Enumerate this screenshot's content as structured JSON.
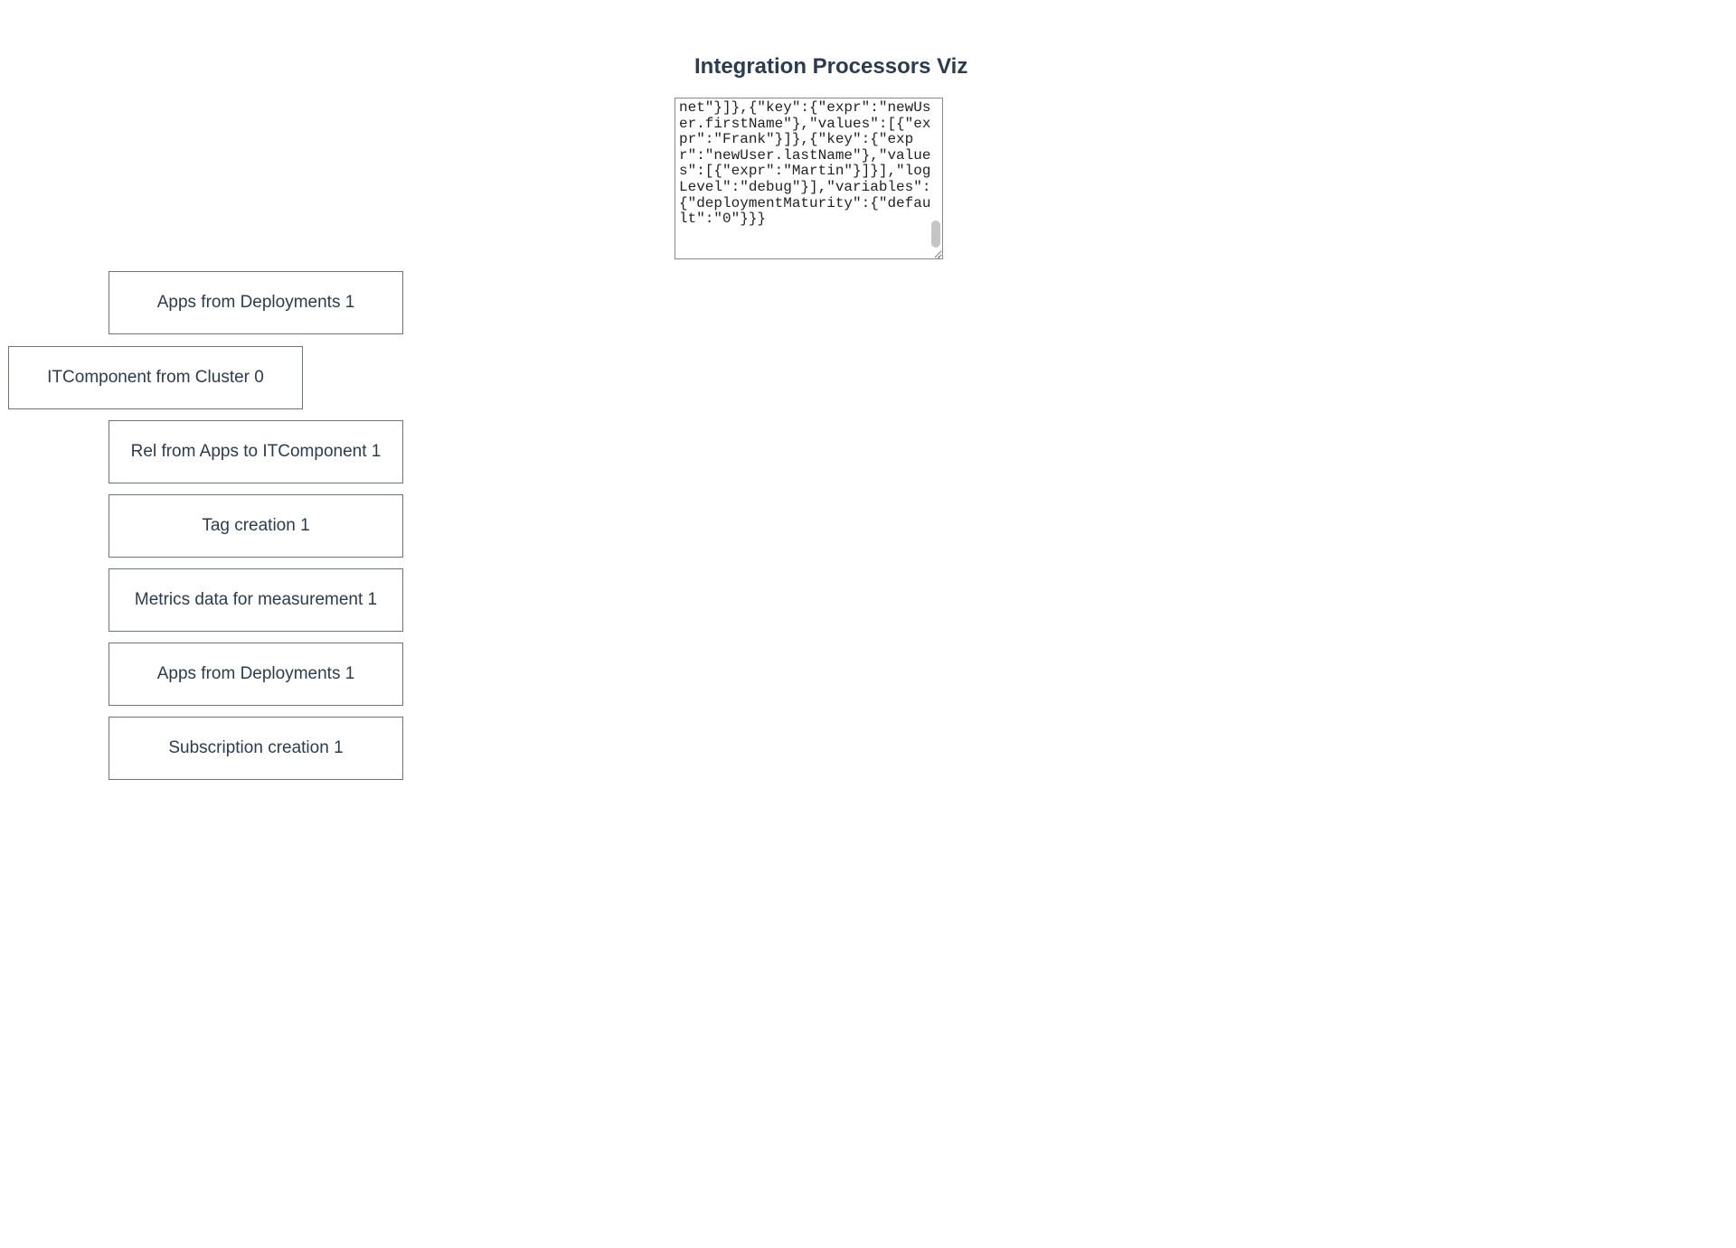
{
  "header": {
    "title": "Integration Processors Viz"
  },
  "json_content": "net\"}]},{\"key\":{\"expr\":\"newUser.firstName\"},\"values\":[{\"expr\":\"Frank\"}]},{\"key\":{\"expr\":\"newUser.lastName\"},\"values\":[{\"expr\":\"Martin\"}]}],\"logLevel\":\"debug\"}],\"variables\":{\"deploymentMaturity\":{\"default\":\"0\"}}}",
  "nodes": [
    {
      "label": "Apps from Deployments 1"
    },
    {
      "label": "ITComponent from Cluster 0"
    },
    {
      "label": "Rel from Apps to ITComponent 1"
    },
    {
      "label": "Tag creation 1"
    },
    {
      "label": "Metrics data for measurement 1"
    },
    {
      "label": "Apps from Deployments 1"
    },
    {
      "label": "Subscription creation 1"
    }
  ]
}
